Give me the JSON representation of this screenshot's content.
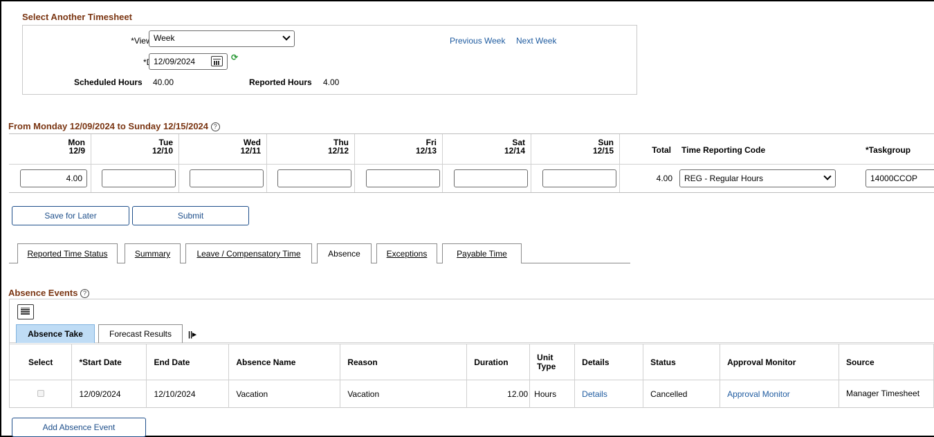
{
  "select_section": {
    "title": "Select Another Timesheet",
    "view_by_label": "*View By",
    "view_by_value": "Week",
    "date_label": "*Date",
    "date_value": "12/09/2024",
    "prev_link": "Previous Week",
    "next_link": "Next Week",
    "scheduled_label": "Scheduled Hours",
    "scheduled_value": "40.00",
    "reported_label": "Reported Hours",
    "reported_value": "4.00"
  },
  "period": {
    "title": "From Monday 12/09/2024 to Sunday 12/15/2024",
    "help": "?",
    "days": [
      {
        "name": "Mon",
        "date": "12/9",
        "value": "4.00"
      },
      {
        "name": "Tue",
        "date": "12/10",
        "value": ""
      },
      {
        "name": "Wed",
        "date": "12/11",
        "value": ""
      },
      {
        "name": "Thu",
        "date": "12/12",
        "value": ""
      },
      {
        "name": "Fri",
        "date": "12/13",
        "value": ""
      },
      {
        "name": "Sat",
        "date": "12/14",
        "value": ""
      },
      {
        "name": "Sun",
        "date": "12/15",
        "value": ""
      }
    ],
    "total_label": "Total",
    "total_value": "4.00",
    "trc_label": "Time Reporting Code",
    "trc_value": "REG - Regular Hours",
    "taskgroup_label": "*Taskgroup",
    "taskgroup_value": "14000CCOP"
  },
  "actions": {
    "save_later": "Save for Later",
    "submit": "Submit"
  },
  "tabs": [
    {
      "label": "Reported Time Status"
    },
    {
      "label": "Summary"
    },
    {
      "label": "Leave / Compensatory Time"
    },
    {
      "label": "Absence"
    },
    {
      "label": "Exceptions"
    },
    {
      "label": "Payable Time"
    }
  ],
  "absence": {
    "title": "Absence Events",
    "help": "?",
    "subtabs": [
      "Absence Take",
      "Forecast Results"
    ],
    "columns": [
      "Select",
      "*Start Date",
      "End Date",
      "Absence Name",
      "Reason",
      "Duration",
      "Unit Type",
      "Details",
      "Status",
      "Approval Monitor",
      "Source"
    ],
    "rows": [
      {
        "start": "12/09/2024",
        "end": "12/10/2024",
        "name": "Vacation",
        "reason": "Vacation",
        "duration": "12.00",
        "unit": "Hours",
        "details": "Details",
        "status": "Cancelled",
        "approval": "Approval Monitor",
        "source": "Manager Timesheet"
      }
    ],
    "add_button": "Add Absence Event"
  },
  "colors": {
    "section_title": "#7a3512",
    "link": "#1d5a9f",
    "active_tab_bg": "#bfdcf5"
  }
}
